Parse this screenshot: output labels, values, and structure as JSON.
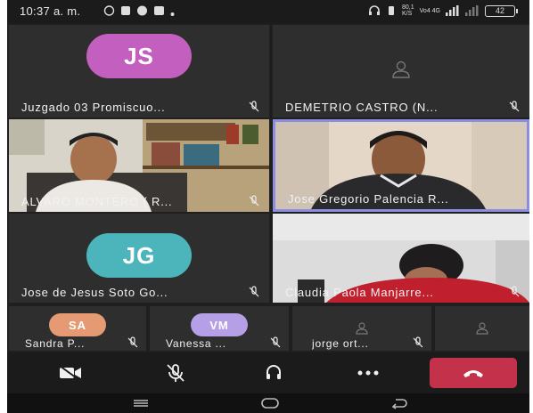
{
  "status_bar": {
    "time": "10:37 a. m.",
    "network_speed": "80,1\nK/S",
    "carrier": "Vo4 4G",
    "battery": "42"
  },
  "participants": [
    {
      "id": "jp",
      "initials": "JS",
      "name": "Juzgado 03 Promiscuo...",
      "avatar_color": "#c35fbe",
      "kind": "avatar"
    },
    {
      "id": "dc",
      "initials": "",
      "name": "DEMETRIO CASTRO (N...",
      "kind": "placeholder"
    },
    {
      "id": "am",
      "name": "ALVARO MONTERO ( R...",
      "kind": "video"
    },
    {
      "id": "jg",
      "name": "Jose Gregorio Palencia R...",
      "kind": "video",
      "active": true
    },
    {
      "id": "js",
      "initials": "JG",
      "name": "Jose de Jesus Soto Go...",
      "avatar_color": "#4cb5bb",
      "kind": "avatar"
    },
    {
      "id": "cp",
      "name": "Claudia Paola Manjarre...",
      "kind": "video"
    }
  ],
  "small_participants": [
    {
      "initials": "SA",
      "name": "Sandra P...",
      "avatar_color": "#e59a73"
    },
    {
      "initials": "VM",
      "name": "Vanessa ...",
      "avatar_color": "#b5a0e8"
    },
    {
      "initials": "",
      "name": "jorge ort...",
      "avatar_color": ""
    },
    {
      "initials": "",
      "name": "",
      "avatar_color": ""
    }
  ],
  "toolbar": {
    "camera": "camera-off-icon",
    "mic": "mic-off-icon",
    "speaker": "speaker-icon",
    "more": "more-icon",
    "end_call": "end-call-icon"
  },
  "colors": {
    "end_call": "#c4314b",
    "active_border": "#8b8de0"
  }
}
